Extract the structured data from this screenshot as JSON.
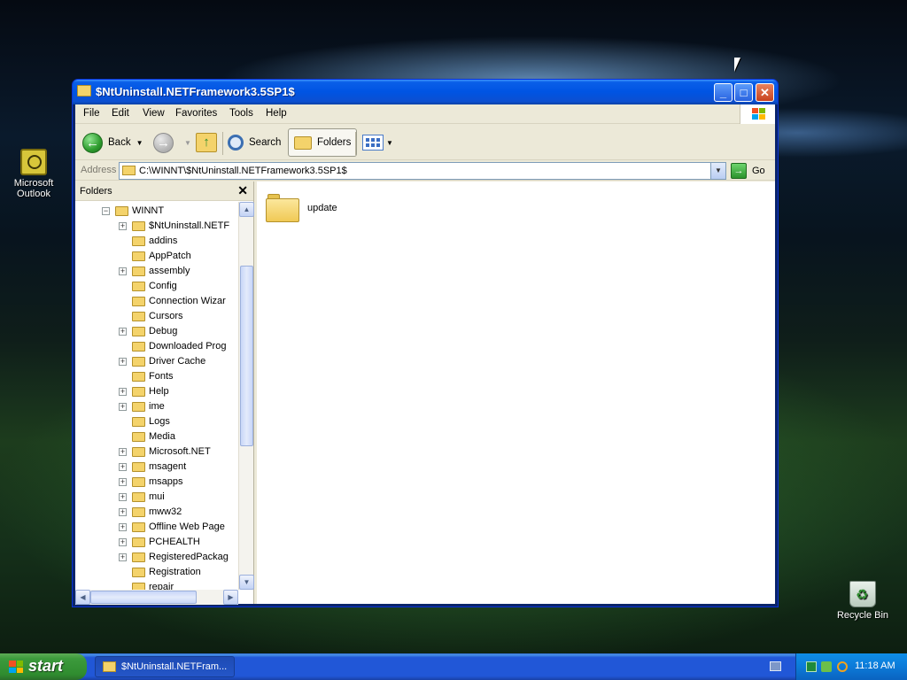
{
  "desktop": {
    "icons": [
      {
        "label_line1": "Microsoft",
        "label_line2": "Outlook",
        "icon": "outlook-icon"
      },
      {
        "label": "Recycle Bin",
        "icon": "recycle-bin-icon"
      }
    ]
  },
  "window": {
    "title": "$NtUninstall.NETFramework3.5SP1$",
    "buttons": {
      "minimize": "_",
      "maximize": "□",
      "close": "✕"
    },
    "menu": [
      "File",
      "Edit",
      "View",
      "Favorites",
      "Tools",
      "Help"
    ],
    "toolbar": {
      "back": "Back",
      "search": "Search",
      "folders": "Folders"
    },
    "address": {
      "label": "Address",
      "value": "C:\\WINNT\\$NtUninstall.NETFramework3.5SP1$",
      "go": "Go"
    },
    "folder_pane": {
      "title": "Folders",
      "close": "✕",
      "tree": [
        {
          "label": "WINNT",
          "level": 0,
          "expander": "−",
          "selected": false
        },
        {
          "label": "$NtUninstall.NETF",
          "level": 1,
          "expander": "+",
          "selected": false
        },
        {
          "label": "addins",
          "level": 1,
          "expander": "",
          "selected": false
        },
        {
          "label": "AppPatch",
          "level": 1,
          "expander": "",
          "selected": false
        },
        {
          "label": "assembly",
          "level": 1,
          "expander": "+",
          "selected": false
        },
        {
          "label": "Config",
          "level": 1,
          "expander": "",
          "selected": false
        },
        {
          "label": "Connection Wizar",
          "level": 1,
          "expander": "",
          "selected": false
        },
        {
          "label": "Cursors",
          "level": 1,
          "expander": "",
          "selected": false
        },
        {
          "label": "Debug",
          "level": 1,
          "expander": "+",
          "selected": false
        },
        {
          "label": "Downloaded Prog",
          "level": 1,
          "expander": "",
          "selected": false
        },
        {
          "label": "Driver Cache",
          "level": 1,
          "expander": "+",
          "selected": false
        },
        {
          "label": "Fonts",
          "level": 1,
          "expander": "",
          "selected": false
        },
        {
          "label": "Help",
          "level": 1,
          "expander": "+",
          "selected": false
        },
        {
          "label": "ime",
          "level": 1,
          "expander": "+",
          "selected": false
        },
        {
          "label": "Logs",
          "level": 1,
          "expander": "",
          "selected": false
        },
        {
          "label": "Media",
          "level": 1,
          "expander": "",
          "selected": false
        },
        {
          "label": "Microsoft.NET",
          "level": 1,
          "expander": "+",
          "selected": false
        },
        {
          "label": "msagent",
          "level": 1,
          "expander": "+",
          "selected": false
        },
        {
          "label": "msapps",
          "level": 1,
          "expander": "+",
          "selected": false
        },
        {
          "label": "mui",
          "level": 1,
          "expander": "+",
          "selected": false
        },
        {
          "label": "mww32",
          "level": 1,
          "expander": "+",
          "selected": false
        },
        {
          "label": "Offline Web Page",
          "level": 1,
          "expander": "+",
          "selected": false
        },
        {
          "label": "PCHEALTH",
          "level": 1,
          "expander": "+",
          "selected": false
        },
        {
          "label": "RegisteredPackag",
          "level": 1,
          "expander": "+",
          "selected": false
        },
        {
          "label": "Registration",
          "level": 1,
          "expander": "",
          "selected": false
        },
        {
          "label": "repair",
          "level": 1,
          "expander": "",
          "selected": false
        }
      ]
    },
    "content": {
      "items": [
        {
          "name": "update",
          "icon": "folder-icon"
        }
      ]
    }
  },
  "taskbar": {
    "start": "start",
    "tasks": [
      {
        "label": "$NtUninstall.NETFram..."
      }
    ],
    "clock": "11:18 AM"
  },
  "colors": {
    "titlebar": "#0054e3",
    "taskbar": "#2157d7",
    "start": "#3c9a3c",
    "folder": "#f4d36b"
  }
}
